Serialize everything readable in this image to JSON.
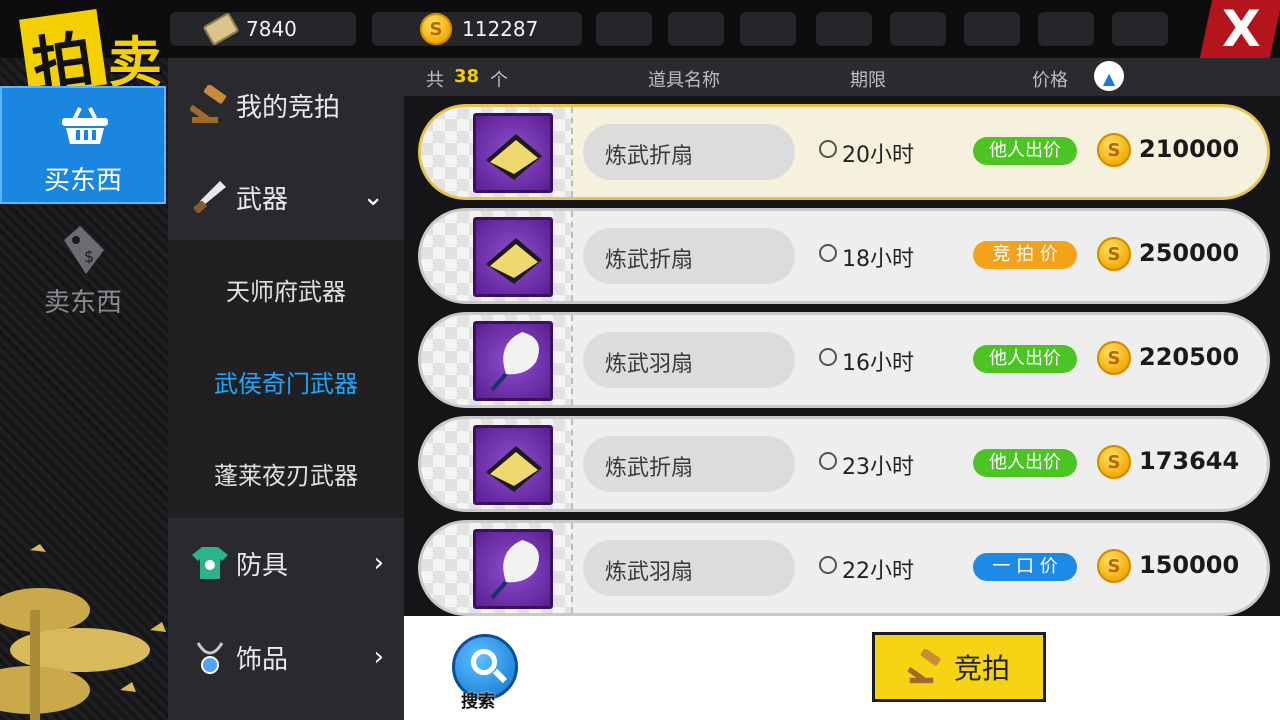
{
  "colors": {
    "accent": "#1ea6ff",
    "green": "#4cc424",
    "orange": "#f3a21b",
    "blue": "#1d8ae6",
    "gold": "#f7d413"
  },
  "logo": {
    "char1": "拍",
    "char2": "卖"
  },
  "resources": {
    "tickets": "7840",
    "coins": "112287"
  },
  "close": {
    "label": "X"
  },
  "tabs": {
    "buy": "买东西",
    "sell": "卖东西"
  },
  "categories": {
    "my_bids": "我的竞拍",
    "weapons": "武器",
    "weapon_subs": [
      "天师府武器",
      "武侯奇门武器",
      "蓬莱夜刃武器"
    ],
    "armor": "防具",
    "accessories": "饰品"
  },
  "header": {
    "total_prefix": "共",
    "total_count": "38",
    "total_suffix": "个",
    "col_name": "道具名称",
    "col_time": "期限",
    "col_price": "价格"
  },
  "items": [
    {
      "name": "炼武折扇",
      "duration": "20小时",
      "badge": "他人出价",
      "badge_color": "green",
      "price": "210000",
      "icon": "folding-fan"
    },
    {
      "name": "炼武折扇",
      "duration": "18小时",
      "badge": "竞 拍 价",
      "badge_color": "orange",
      "price": "250000",
      "icon": "folding-fan"
    },
    {
      "name": "炼武羽扇",
      "duration": "16小时",
      "badge": "他人出价",
      "badge_color": "green",
      "price": "220500",
      "icon": "feather-fan"
    },
    {
      "name": "炼武折扇",
      "duration": "23小时",
      "badge": "他人出价",
      "badge_color": "green",
      "price": "173644",
      "icon": "folding-fan"
    },
    {
      "name": "炼武羽扇",
      "duration": "22小时",
      "badge": "一 口 价",
      "badge_color": "blue",
      "price": "150000",
      "icon": "feather-fan"
    }
  ],
  "bottom": {
    "search_label": "搜索",
    "bid_label": "竞拍"
  }
}
